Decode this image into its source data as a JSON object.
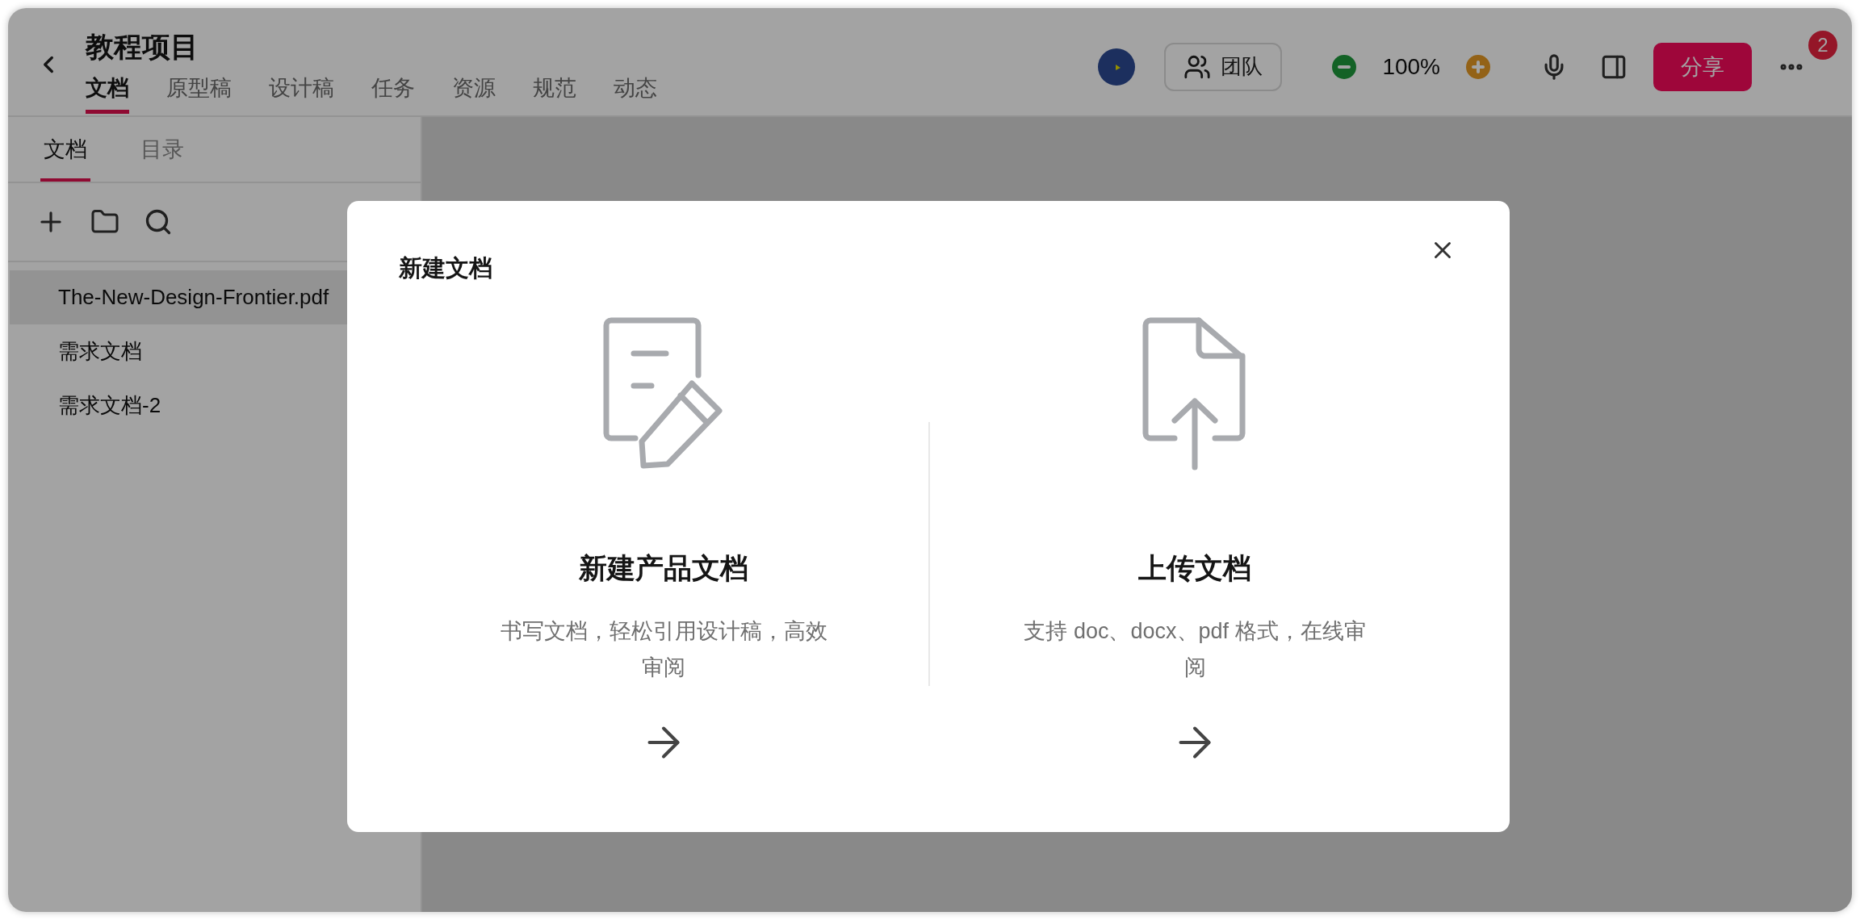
{
  "header": {
    "title": "教程项目",
    "tabs": [
      {
        "label": "文档",
        "selected": true
      },
      {
        "label": "原型稿",
        "selected": false
      },
      {
        "label": "设计稿",
        "selected": false
      },
      {
        "label": "任务",
        "selected": false
      },
      {
        "label": "资源",
        "selected": false
      },
      {
        "label": "规范",
        "selected": false
      },
      {
        "label": "动态",
        "selected": false
      }
    ]
  },
  "toolbar": {
    "team_label": "团队",
    "zoom": "100%",
    "share_label": "分享",
    "notification_count": "2"
  },
  "sidebar": {
    "tabs": [
      {
        "label": "文档",
        "selected": true
      },
      {
        "label": "目录",
        "selected": false
      }
    ],
    "files": [
      {
        "name": "The-New-Design-Frontier.pdf",
        "selected": true
      },
      {
        "name": "需求文档",
        "selected": false
      },
      {
        "name": "需求文档-2",
        "selected": false
      }
    ]
  },
  "dialog": {
    "title": "新建文档",
    "options": [
      {
        "kind": "create",
        "title": "新建产品文档",
        "description": "书写文档，轻松引用设计稿，高效审阅"
      },
      {
        "kind": "upload",
        "title": "上传文档",
        "description": "支持 doc、docx、pdf 格式，在线审阅"
      }
    ]
  }
}
